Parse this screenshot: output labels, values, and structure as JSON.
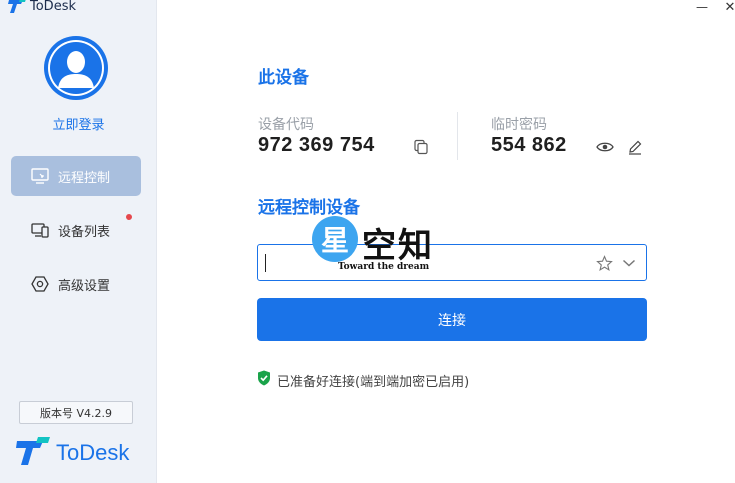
{
  "window": {
    "title": "ToDesk",
    "controls": {
      "minimize": "—",
      "close": "✕"
    }
  },
  "sidebar": {
    "login_label": "立即登录",
    "items": [
      {
        "label": "远程控制",
        "icon": "monitor-icon",
        "active": true
      },
      {
        "label": "设备列表",
        "icon": "devices-icon",
        "active": false,
        "has_notification": true
      },
      {
        "label": "高级设置",
        "icon": "settings-hex-icon",
        "active": false
      }
    ],
    "version": "版本号 V4.2.9",
    "brand_name": "ToDesk"
  },
  "this_device": {
    "title": "此设备",
    "device_code_label": "设备代码",
    "device_code": "972 369 754",
    "temp_password_label": "临时密码",
    "temp_password": "554 862"
  },
  "remote_control": {
    "title": "远程控制设备",
    "input_value": "",
    "connect_label": "连接"
  },
  "status": {
    "text": "已准备好连接(端到端加密已启用)",
    "color": "#1aa34a"
  },
  "watermark": {
    "logo_char": "星",
    "text": "空知",
    "subtitle": "Toward the dream"
  },
  "colors": {
    "accent": "#1a73e8",
    "sidebar_bg": "#eef2f8",
    "active_item_bg": "#a9bfde"
  }
}
